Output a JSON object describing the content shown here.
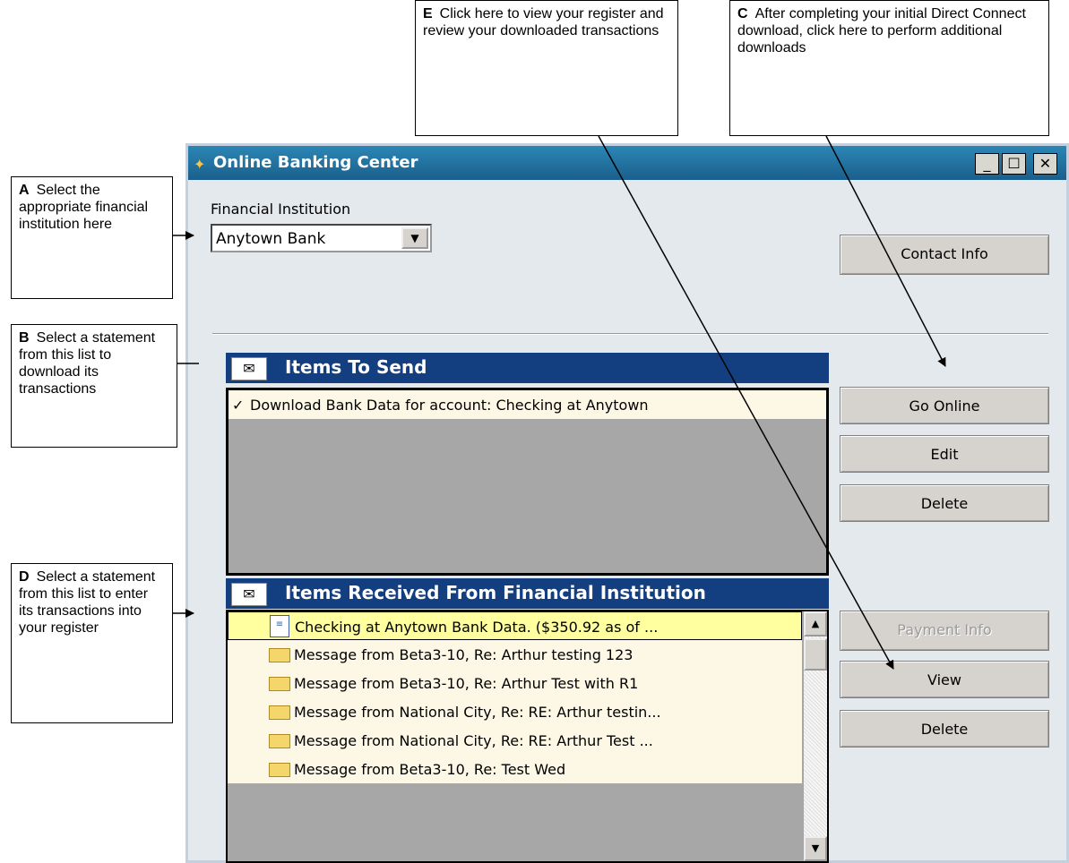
{
  "callouts": {
    "a": {
      "letter": "A",
      "text": "Select the appropriate financial institution here"
    },
    "b": {
      "letter": "B",
      "text": "Select a statement from this list to download its transactions"
    },
    "c": {
      "letter": "C",
      "text": "After completing your initial Direct Connect download, click here to perform additional downloads"
    },
    "d": {
      "letter": "D",
      "text": "Select a statement from this list to enter its transactions into your register"
    },
    "e": {
      "letter": "E",
      "text": "Click here to view your register and review your downloaded transactions"
    }
  },
  "window": {
    "title": "Online Banking Center",
    "icon": "online-banking-icon",
    "minimize": "_",
    "maximize": "☐",
    "close": "✕"
  },
  "institution": {
    "label": "Financial Institution",
    "value": "Anytown Bank"
  },
  "buttons": {
    "contact_info": "Contact Info",
    "go_online": "Go Online",
    "edit": "Edit",
    "delete_send": "Delete",
    "payment_info": "Payment Info",
    "view": "View",
    "delete_received": "Delete"
  },
  "items_to_send": {
    "title": "Items To Send",
    "icon": "mailbox-icon",
    "items": [
      {
        "checked": true,
        "text": "Download Bank Data for account: Checking at Anytown"
      }
    ]
  },
  "items_received": {
    "title": "Items Received From Financial Institution",
    "icon": "mailbox-received-icon",
    "items": [
      {
        "icon": "statement-icon",
        "text": "Checking at Anytown Bank Data.  ($350.92 as of ...",
        "selected": true
      },
      {
        "icon": "message-icon",
        "text": "Message from Beta3-10, Re: Arthur testing 123"
      },
      {
        "icon": "message-icon",
        "text": "Message from Beta3-10, Re: Arthur Test with R1"
      },
      {
        "icon": "message-icon",
        "text": "Message from National City, Re: RE: Arthur testin..."
      },
      {
        "icon": "message-icon",
        "text": "Message from National City, Re: RE: Arthur Test ..."
      },
      {
        "icon": "message-icon",
        "text": "Message from Beta3-10, Re: Test Wed"
      }
    ]
  },
  "colors": {
    "title_bar": "#1a6a9c",
    "panel_header": "#133f80",
    "selected_row": "#ffffa0",
    "list_bg": "#fdf8e6",
    "window_bg": "#e4e9ee"
  }
}
